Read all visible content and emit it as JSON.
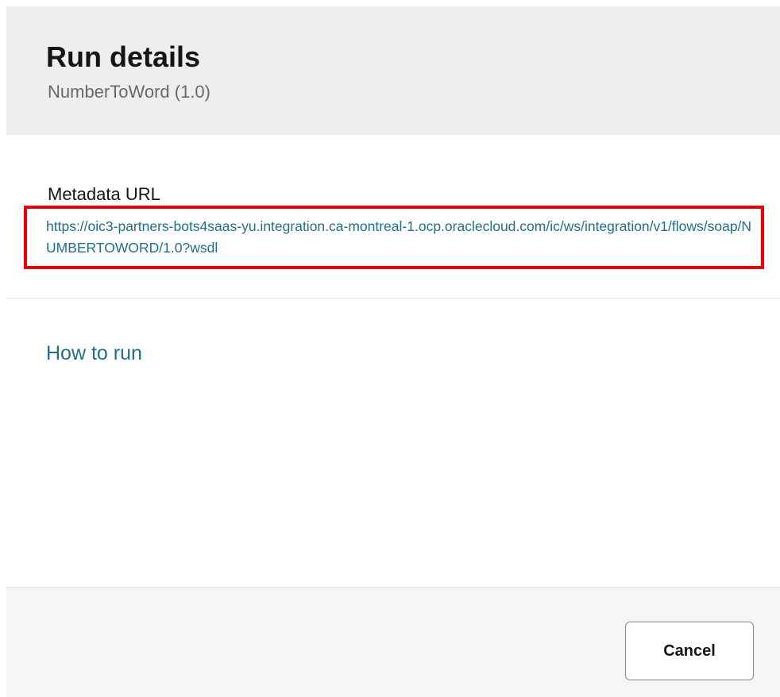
{
  "dialog": {
    "title": "Run details",
    "subtitle": "NumberToWord (1.0)"
  },
  "metadata": {
    "label": "Metadata URL",
    "url": "https://oic3-partners-bots4saas-yu.integration.ca-montreal-1.ocp.oraclecloud.com/ic/ws/integration/v1/flows/soap/NUMBERTOWORD/1.0?wsdl"
  },
  "how_to_run": {
    "label": "How to run"
  },
  "footer": {
    "cancel_label": "Cancel"
  },
  "colors": {
    "link": "#1f6f8b",
    "highlight_border": "#ee0000",
    "header_background": "#efeeec"
  }
}
